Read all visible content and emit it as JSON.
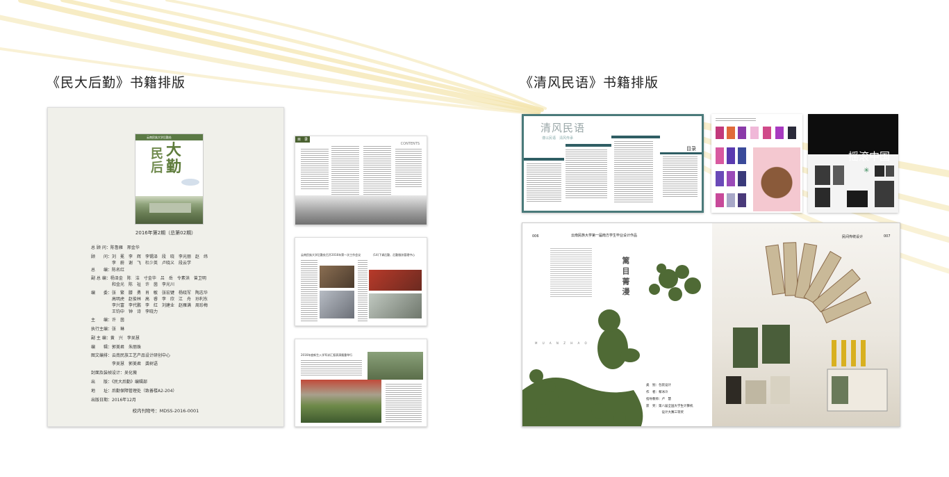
{
  "sections": [
    {
      "title": "《民大后勤》书籍排版"
    },
    {
      "title": "《清风民语》书籍排版"
    }
  ],
  "colophon": {
    "cover_band": "云南民族大学后勤处",
    "cover_chars": [
      "民",
      "大",
      "后",
      "勤"
    ],
    "issue": "2016年第2期（总第02期）",
    "lines": [
      "总 顾 问：陈鲁雁　邢金华",
      "顾　　问：刘　冕　李　辉　李锡泽　段　晓　李光丽　赵　纬",
      "　　　　　李　蔚　谢　飞　杜少英　卢晓义　段云学",
      "总　　编：陈名红",
      "副 总 编：杨泽金　陈　洁　寸金华　吕　岳　令素洪　曾卫明",
      "　　　　　和金光　陈　祉　许　茵　李光川",
      "编　　委：张　繁　滕　勇　肖　敏　张宏键　杨晓军　陶志华",
      "　　　　　高明虎　赵俊林　高　睿　李　欣　江　舟　孙利东",
      "　　　　　李兴富　李代鹏　李　红　刘建业　赵雁满　周珍梅",
      "　　　　　王钧中　钟　诗　李晓力",
      "主　　编：许　茵",
      "执行主编：张　琳",
      "副 主 编：黄　兴　李吴慧",
      "编　　辑：郭美君　朱丽珠",
      "图文编排：云南民族工艺产品设计研创中心",
      "　　　　　李吴慧　郭美君　龚树语",
      "封面及装帧设计：吴化薇",
      "出　　版：《民大后勤》编辑部",
      "地　　址：后勤保障管理处（致善楼A2-204）",
      "出版日期：2016年12月"
    ],
    "footer": "校内刊物号：MDSS-2016-0001"
  },
  "thumb_toc": {
    "tag": "目　录",
    "label": "CONTENTS"
  },
  "thumb_news1": {
    "headline_left": "云南民族大学后勤处召开2016年第一次工作会议",
    "headline_right": "(14)下调后勤、后勤服务管理中心"
  },
  "thumb_news2": {
    "headline": "2016年度新生入学军训汇报表演隆重举行"
  },
  "qingfeng": {
    "title": "清风民语",
    "subtitle": "谨以民语　清风传承",
    "mulu": "目录"
  },
  "yaogun": {
    "title": "摇滚中国"
  },
  "spread": {
    "header": "云南民族大学第一届南方学生毕业设计作品",
    "page_left": "006",
    "page_right": "007",
    "header_right": "民间传统设计",
    "vertical_title": "篱 目 菁 漫",
    "pinyin": "M U A N  Z H A O",
    "credits": [
      "类　别：包装设计",
      "作　者：黎冰冷",
      "指导教师：卢　慧",
      "获　奖：第八届全国大学生计算机",
      "　　　　　设计大赛三等奖"
    ]
  },
  "colors": {
    "accent_green": "#4f6a35",
    "teal_frame": "#4a7a7a",
    "ray_yellow": "#f2e2a8"
  }
}
